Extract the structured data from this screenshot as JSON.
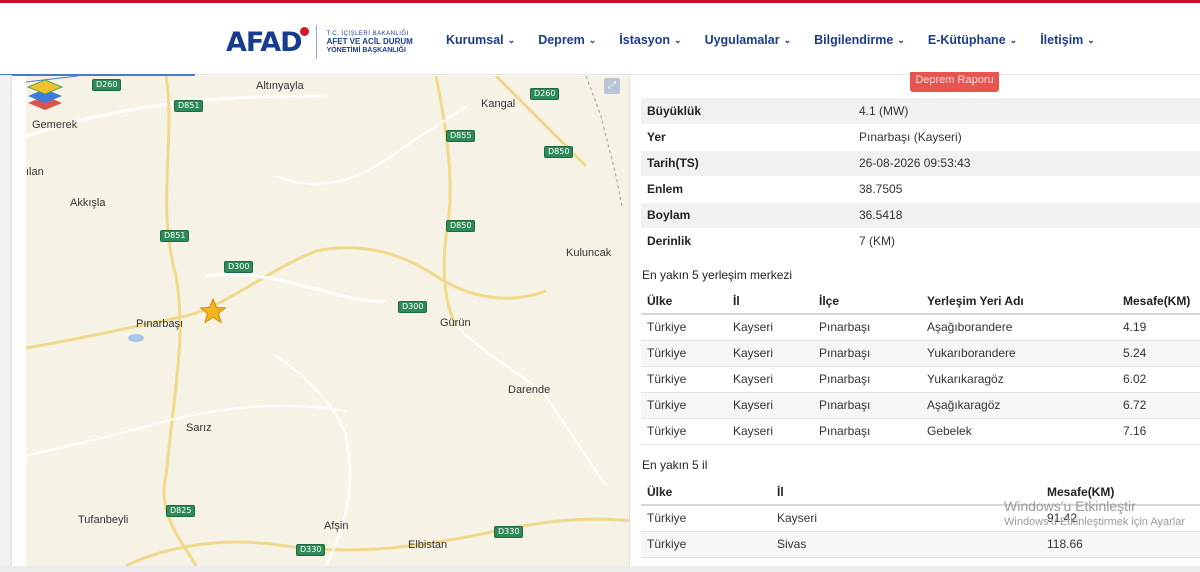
{
  "header": {
    "logo_mark": "AFAD",
    "logo_line1": "T.C. İÇİŞLERİ BAKANLIĞI",
    "logo_line2": "AFET VE ACİL DURUM",
    "logo_line3": "YÖNETİMİ BAŞKANLIĞI",
    "nav": [
      "Kurumsal",
      "Deprem",
      "İstasyon",
      "Uygulamalar",
      "Bilgilendirme",
      "E-Kütüphane",
      "İletişim"
    ]
  },
  "map": {
    "places": [
      "Altınyayla",
      "Kangal",
      "Gemerek",
      "ılan",
      "Akkışla",
      "Kuluncak",
      "Pınarbaşı",
      "Gürün",
      "Darende",
      "Sarız",
      "Tufanbeyli",
      "Afşin",
      "Elbistan"
    ],
    "roads": [
      "D260",
      "D851",
      "D260",
      "D855",
      "D850",
      "D851",
      "D850",
      "D300",
      "D300",
      "D825",
      "D330",
      "D330"
    ],
    "epicenter_icon": "star-icon",
    "layers_icon": "layers-icon",
    "fullscreen_icon": "expand-icon"
  },
  "report_button": "Deprem Raporu",
  "info": [
    {
      "k": "Büyüklük",
      "v": "4.1 (MW)"
    },
    {
      "k": "Yer",
      "v": "Pınarbaşı (Kayseri)"
    },
    {
      "k": "Tarih(TS)",
      "v": "26-08-2026 09:53:43"
    },
    {
      "k": "Enlem",
      "v": "38.7505"
    },
    {
      "k": "Boylam",
      "v": "36.5418"
    },
    {
      "k": "Derinlik",
      "v": "7 (KM)"
    }
  ],
  "settlements": {
    "title": "En yakın 5 yerleşim merkezi",
    "headers": [
      "Ülke",
      "İl",
      "İlçe",
      "Yerleşim Yeri Adı",
      "Mesafe(KM)"
    ],
    "rows": [
      [
        "Türkiye",
        "Kayseri",
        "Pınarbaşı",
        "Aşağıborandere",
        "4.19"
      ],
      [
        "Türkiye",
        "Kayseri",
        "Pınarbaşı",
        "Yukarıborandere",
        "5.24"
      ],
      [
        "Türkiye",
        "Kayseri",
        "Pınarbaşı",
        "Yukarıkaragöz",
        "6.02"
      ],
      [
        "Türkiye",
        "Kayseri",
        "Pınarbaşı",
        "Aşağıkaragöz",
        "6.72"
      ],
      [
        "Türkiye",
        "Kayseri",
        "Pınarbaşı",
        "Gebelek",
        "7.16"
      ]
    ]
  },
  "provinces": {
    "title": "En yakın 5 il",
    "headers": [
      "Ülke",
      "İl",
      "Mesafe(KM)"
    ],
    "rows": [
      [
        "Türkiye",
        "Kayseri",
        "91.42"
      ],
      [
        "Türkiye",
        "Sivas",
        "118.66"
      ]
    ]
  },
  "watermark": {
    "line1": "Windows'u Etkinleştir",
    "line2": "Windows'u Etkinleştirmek için Ayarlar"
  }
}
